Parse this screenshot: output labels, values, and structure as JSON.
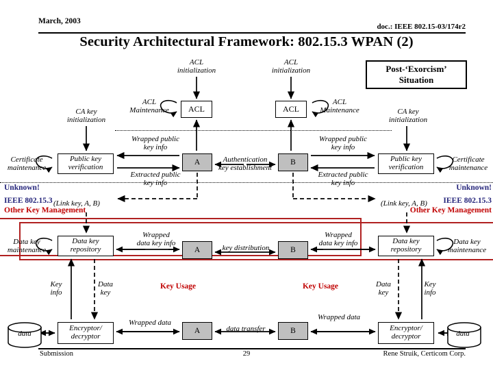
{
  "header": {
    "date": "March, 2003",
    "doc": "doc.: IEEE 802.15-03/174r2",
    "title": "Security Architectural Framework: 802.15.3 WPAN (2)"
  },
  "footer": {
    "left": "Submission",
    "page": "29",
    "right": "Rene Struik, Certicom Corp."
  },
  "callout": {
    "line1": "Post-‘Exorcism’",
    "line2": "Situation"
  },
  "left_column": {
    "acl_init": "ACL\ninitialization",
    "acl_box": "ACL",
    "acl_maintenance": "ACL\nMaintenance",
    "ca_key_init": "CA key\ninitialization",
    "cert_maintenance": "Certificate\nmaintenance",
    "pubkey_verification": "Public key\nverification",
    "wrapped_public_key_info": "Wrapped public\nkey info",
    "extracted_public_key_info": "Extracted public\nkey info",
    "unknown": "Unknown!",
    "ieee": "IEEE 802.15.3",
    "other_key_mgmt": "Other Key Management",
    "link_key": "(Link key, A, B)",
    "data_key_maintenance": "Data key\nmaintenance",
    "data_key_repository": "Data key\nrepository",
    "wrapped_data_key_info": "Wrapped\ndata key info",
    "key_info": "Key\ninfo",
    "data_key": "Data\nkey",
    "encryptor": "Encryptor/\ndecryptor",
    "data_store": "data",
    "wrapped_data": "Wrapped data"
  },
  "right_column": {
    "acl_init": "ACL\ninitialization",
    "acl_box": "ACL",
    "acl_maintenance": "ACL\nMaintenance",
    "ca_key_init": "CA key\ninitialization",
    "cert_maintenance": "Certificate\nmaintenance",
    "pubkey_verification": "Public key\nverification",
    "wrapped_public_key_info": "Wrapped public\nkey info",
    "extracted_public_key_info": "Extracted public\nkey info",
    "unknown": "Unknown!",
    "ieee": "IEEE 802.15.3",
    "other_key_mgmt": "Other Key Management",
    "link_key": "(Link key, A, B)",
    "data_key_maintenance": "Data key\nmaintenance",
    "data_key_repository": "Data key\nrepository",
    "wrapped_data_key_info": "Wrapped\ndata key info",
    "key_info": "Key\ninfo",
    "data_key": "Data\nkey",
    "encryptor": "Encryptor/\ndecryptor",
    "data_store": "data",
    "wrapped_data": "Wrapped data"
  },
  "nodes": {
    "a": "A",
    "b": "B"
  },
  "center_labels": {
    "auth_key_establishment": "Authentication\nkey establishment",
    "key_distribution": "key distribution",
    "data_transfer": "data transfer"
  },
  "key_usage_label": "Key Usage",
  "colors": {
    "node_fill": "#bfbfbf",
    "blue_text": "#24247a",
    "red_text": "#c00000",
    "red_frame": "#b02020",
    "line": "#000000"
  }
}
